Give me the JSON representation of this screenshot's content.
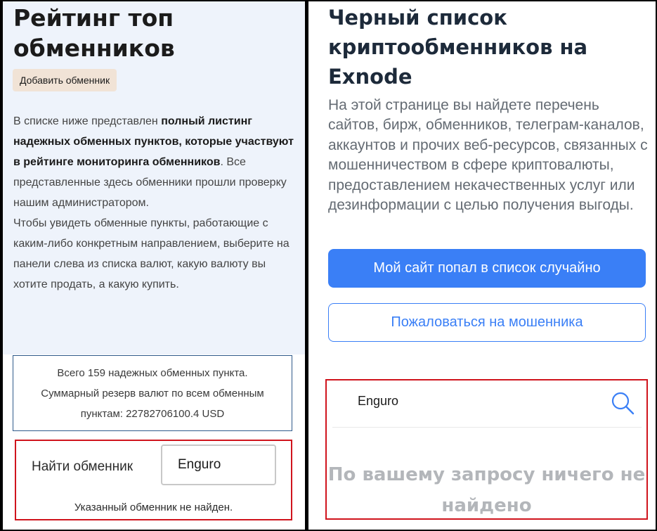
{
  "left": {
    "title": "Рейтинг топ обменников",
    "add_button": "Добавить обменник",
    "description": {
      "p1_lead": "В списке ниже представлен ",
      "p1_bold": "полный листинг надежных обменных пунктов, которые участвуют в рейтинге мониторинга обменников",
      "p1_tail": ". Все представленные здесь обменники прошли проверку нашим администратором.",
      "p2": "Чтобы увидеть обменные пункты, работающие с каким-либо конкретным направлением, выберите на панели слева из списка валют, какую валюту вы хотите продать, а какую купить."
    },
    "stats": {
      "line1": "Всего 159 надежных обменных пункта.",
      "line2": "Суммарный резерв валют по всем обменным",
      "line3": "пунктам: 22782706100.4 USD"
    },
    "find": {
      "label": "Найти обменник",
      "value": "Enguro",
      "result": "Указанный обменник не найден."
    }
  },
  "right": {
    "title": "Черный список криптообменников на Exnode",
    "description": "На этой странице вы найдете перечень сайтов, бирж, обменников, телеграм-каналов, аккаунтов и прочих веб-ресурсов, связанных с мошенничеством в сфере криптовалюты, предоставлением некачественных услуг или дезинформации с целью получения выгоды.",
    "primary_button": "Мой сайт попал в список случайно",
    "outline_button": "Пожаловаться на мошенника",
    "search": {
      "value": "Enguro",
      "icon": "search-icon",
      "no_results": "По вашему запросу ничего не найдено"
    }
  },
  "colors": {
    "accent_blue": "#3a7ff6",
    "highlight_red": "#d0141d",
    "panel_bg": "#eef3fb",
    "add_button_bg": "#f1e3d6"
  }
}
